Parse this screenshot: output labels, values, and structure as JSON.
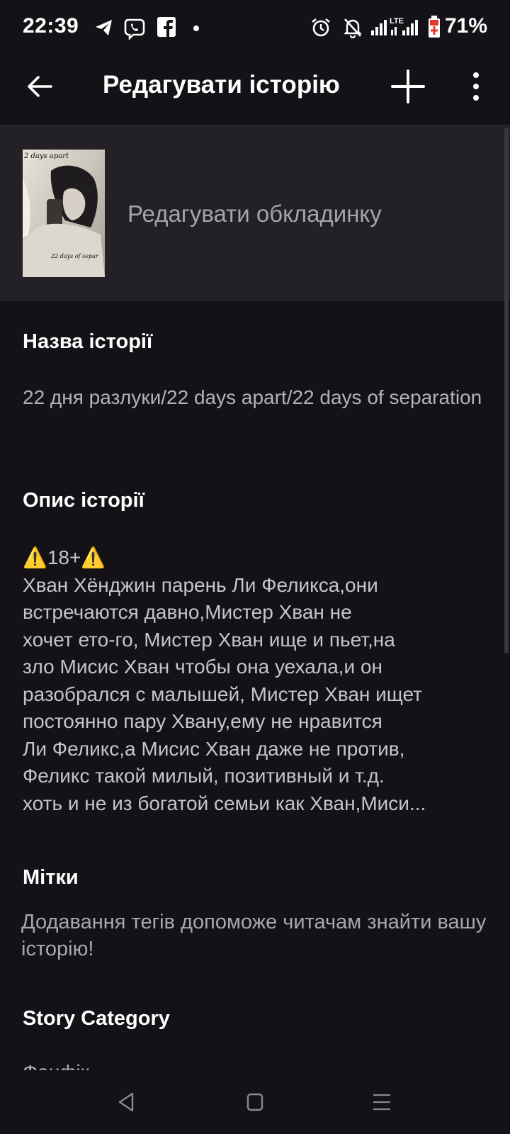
{
  "status_bar": {
    "time": "22:39",
    "icons_left": [
      "telegram-icon",
      "viber-icon",
      "facebook-icon",
      "notification-dot-icon"
    ],
    "icons_right": [
      "alarm-icon",
      "bell-off-icon",
      "signal-icon",
      "lte-signal-icon",
      "battery-icon"
    ],
    "network_label": "LTE",
    "battery": "71%"
  },
  "app_bar": {
    "title": "Редагувати історію"
  },
  "cover": {
    "thumb_text_top": "2 days apart",
    "thumb_text_bottom": "22 days of separ",
    "edit_label": "Редагувати обкладинку"
  },
  "story_title": {
    "label": "Назва історії",
    "value": "22 дня разлуки/22 days apart/22 days of separation"
  },
  "description": {
    "label": "Опис історії",
    "lines": [
      "⚠️18+⚠️",
      "Хван Хёнджин парень Ли Феликса,они",
      "встречаются давно,Мистер Хван не",
      "хочет ето-го, Мистер Хван ище и пьет,на",
      "зло Мисис Хван чтобы она уехала,и он",
      "разобрался с малышей, Мистер Хван ищет",
      "постоянно пару Хвану,ему не нравится",
      "Ли Феликс,а Мисис Хван даже не против,",
      "Феликс такой милый, позитивный и т.д.",
      "хоть и не из богатой семьи как Хван,Миси..."
    ]
  },
  "tags": {
    "label": "Мітки",
    "hint": "Додавання тегів допоможе читачам знайти вашу історію!"
  },
  "category": {
    "label": "Story Category",
    "value": "Фанфік"
  },
  "colors": {
    "background": "#141216",
    "cover_section": "#232125",
    "primary_text": "#ffffff",
    "secondary_text": "#b4b2b6"
  }
}
